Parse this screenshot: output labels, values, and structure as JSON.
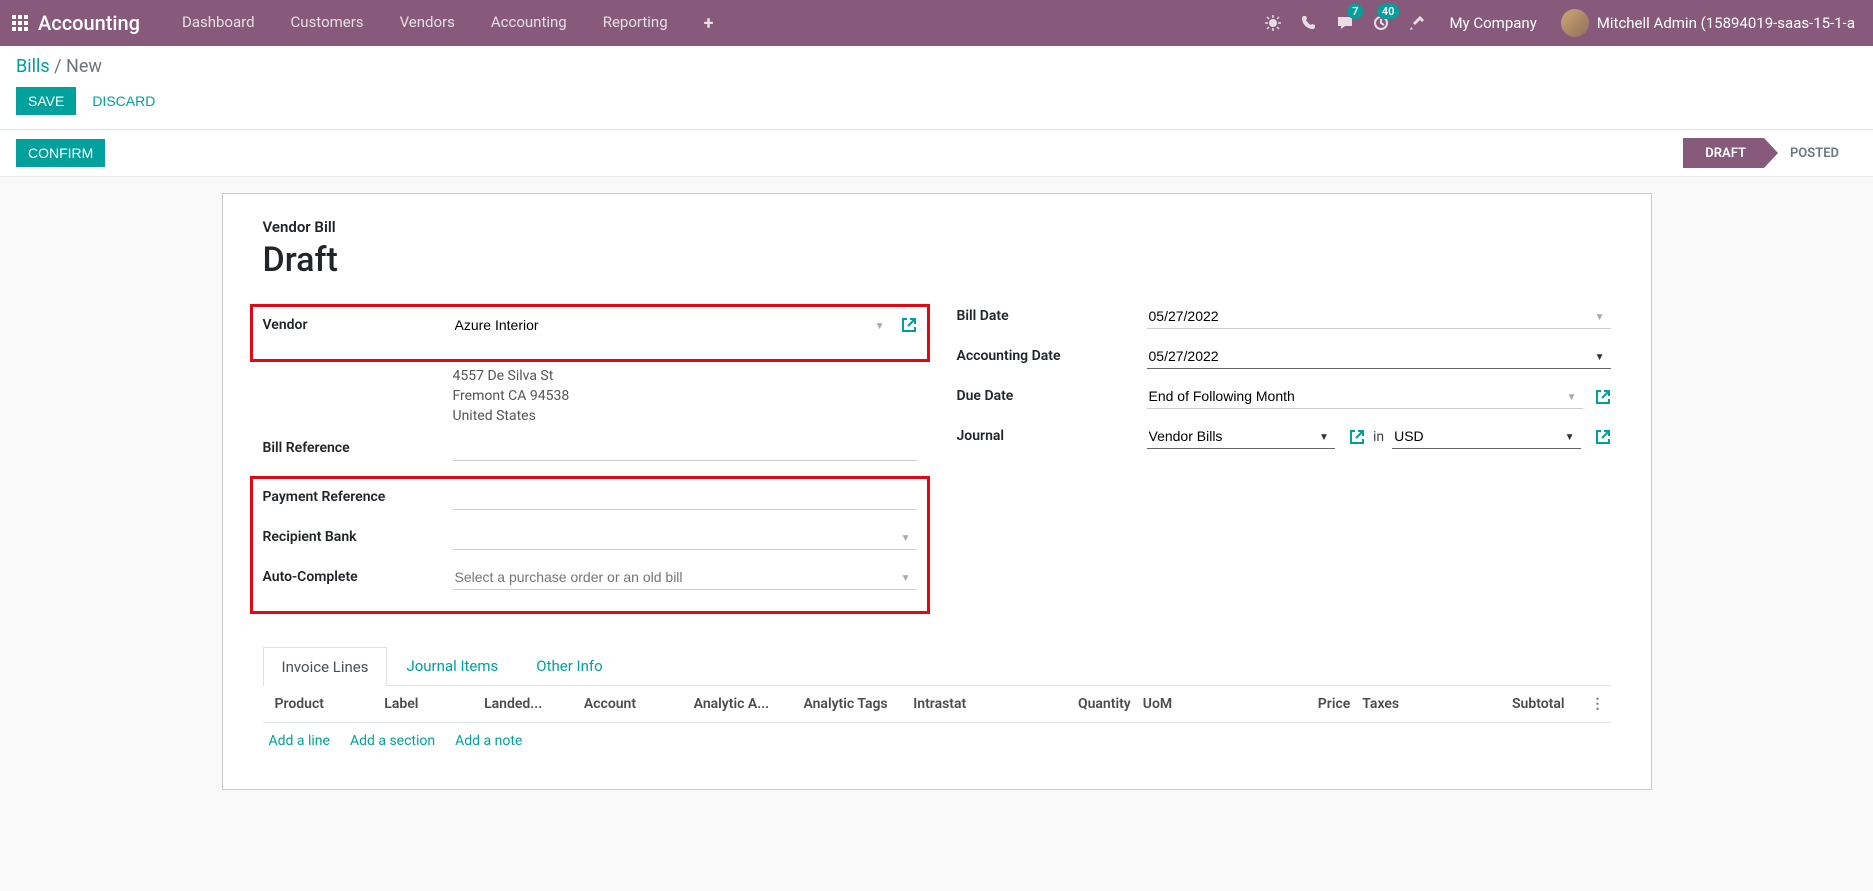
{
  "navbar": {
    "brand": "Accounting",
    "menu": [
      "Dashboard",
      "Customers",
      "Vendors",
      "Accounting",
      "Reporting"
    ],
    "messages_badge": "7",
    "activities_badge": "40",
    "company": "My Company",
    "user": "Mitchell Admin (15894019-saas-15-1-a"
  },
  "breadcrumb": {
    "link": "Bills",
    "sep": " / ",
    "current": "New"
  },
  "buttons": {
    "save": "SAVE",
    "discard": "DISCARD",
    "confirm": "CONFIRM"
  },
  "status": {
    "draft": "DRAFT",
    "posted": "POSTED"
  },
  "header": {
    "subtitle": "Vendor Bill",
    "title": "Draft"
  },
  "left": {
    "vendor_label": "Vendor",
    "vendor_value": "Azure Interior",
    "addr1": "4557 De Silva St",
    "addr2": "Fremont CA 94538",
    "addr3": "United States",
    "bill_ref_label": "Bill Reference",
    "bill_ref_value": "",
    "pay_ref_label": "Payment Reference",
    "pay_ref_value": "",
    "bank_label": "Recipient Bank",
    "bank_value": "",
    "auto_label": "Auto-Complete",
    "auto_placeholder": "Select a purchase order or an old bill"
  },
  "right": {
    "bill_date_label": "Bill Date",
    "bill_date_value": "05/27/2022",
    "acct_date_label": "Accounting Date",
    "acct_date_value": "05/27/2022",
    "due_date_label": "Due Date",
    "due_date_value": "End of Following Month",
    "journal_label": "Journal",
    "journal_value": "Vendor Bills",
    "journal_in": "in",
    "currency_value": "USD"
  },
  "tabs": [
    "Invoice Lines",
    "Journal Items",
    "Other Info"
  ],
  "columns": {
    "product": "Product",
    "label": "Label",
    "landed": "Landed...",
    "account": "Account",
    "analytic_a": "Analytic A...",
    "analytic_t": "Analytic Tags",
    "intrastat": "Intrastat",
    "quantity": "Quantity",
    "uom": "UoM",
    "price": "Price",
    "taxes": "Taxes",
    "subtotal": "Subtotal"
  },
  "line_actions": {
    "add_line": "Add a line",
    "add_section": "Add a section",
    "add_note": "Add a note"
  }
}
